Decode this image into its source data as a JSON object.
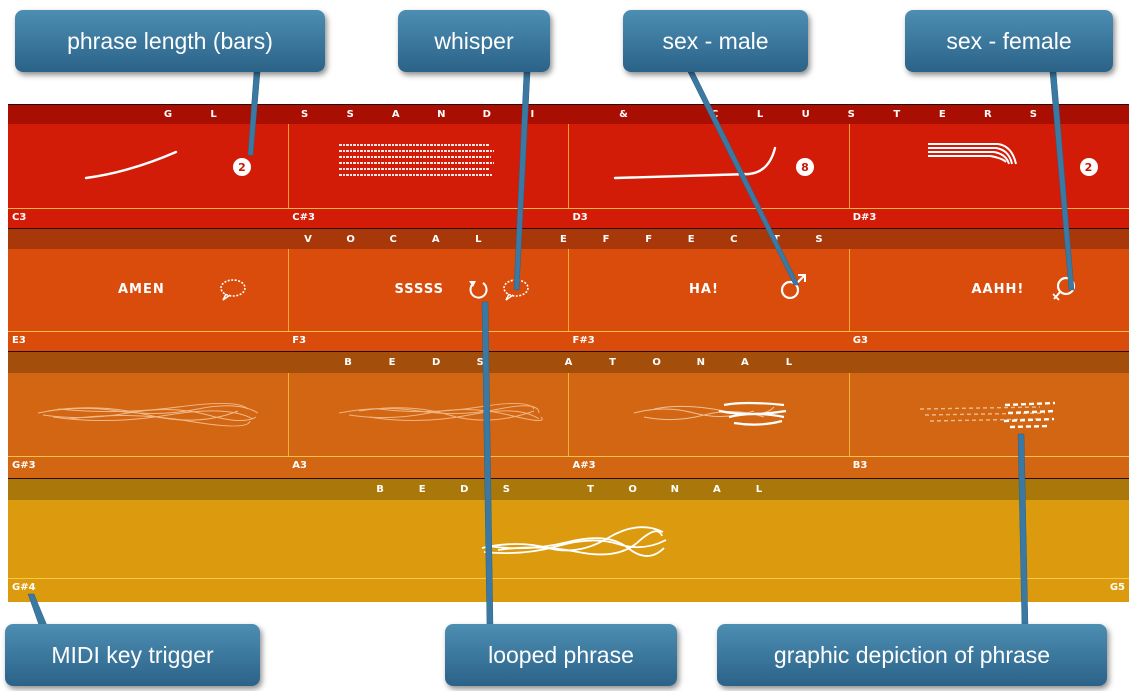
{
  "sections": [
    {
      "name": "glissandi",
      "letters": [
        "G",
        "L",
        "",
        "S",
        "S",
        "A",
        "N",
        "D",
        "I",
        "",
        "&",
        "",
        "C",
        "L",
        "U",
        "S",
        "T",
        "E",
        "R",
        "S",
        ""
      ]
    },
    {
      "name": "vocal_effects",
      "letters": [
        "V",
        "O",
        "C",
        "A",
        "L",
        "",
        "E",
        "F",
        "F",
        "E",
        "C",
        "T",
        "S"
      ]
    },
    {
      "name": "beds_atonal",
      "letters": [
        "B",
        "E",
        "D",
        "S",
        "",
        "A",
        "T",
        "O",
        "N",
        "A",
        "L"
      ]
    },
    {
      "name": "beds_tonal",
      "letters": [
        "B",
        "E",
        "D",
        "S",
        "",
        "T",
        "O",
        "N",
        "A",
        "L"
      ]
    }
  ],
  "row1": {
    "keys": [
      "C3",
      "C#3",
      "D3",
      "D#3"
    ],
    "badges": [
      "2",
      "8",
      "2"
    ]
  },
  "row2": {
    "keys": [
      "E3",
      "F3",
      "F#3",
      "G3"
    ],
    "texts": [
      "AMEN",
      "SSSSS",
      "HA!",
      "AAHH!"
    ],
    "icons": [
      "speech-bubble-icon",
      "loop-icon",
      "male-symbol-icon",
      "female-symbol-icon"
    ]
  },
  "row3": {
    "keys": [
      "G#3",
      "A3",
      "A#3",
      "B3"
    ]
  },
  "row4": {
    "keys": [
      "G#4",
      "G5"
    ]
  },
  "callouts": {
    "phrase_length": "phrase length (bars)",
    "whisper": "whisper",
    "sex_male": "sex - male",
    "sex_female": "sex - female",
    "midi_key": "MIDI key trigger",
    "looped_phrase": "looped phrase",
    "graphic_depiction": "graphic depiction of phrase"
  },
  "colors": {
    "row1": "#d21c08",
    "band1": "#a90e02",
    "row2": "#d94c0c",
    "band2": "#a8380a",
    "row3": "#d36612",
    "band3": "#a44e0c",
    "row4": "#dc9a0e",
    "band4": "#aa780a",
    "callout": "#3b79a2"
  }
}
